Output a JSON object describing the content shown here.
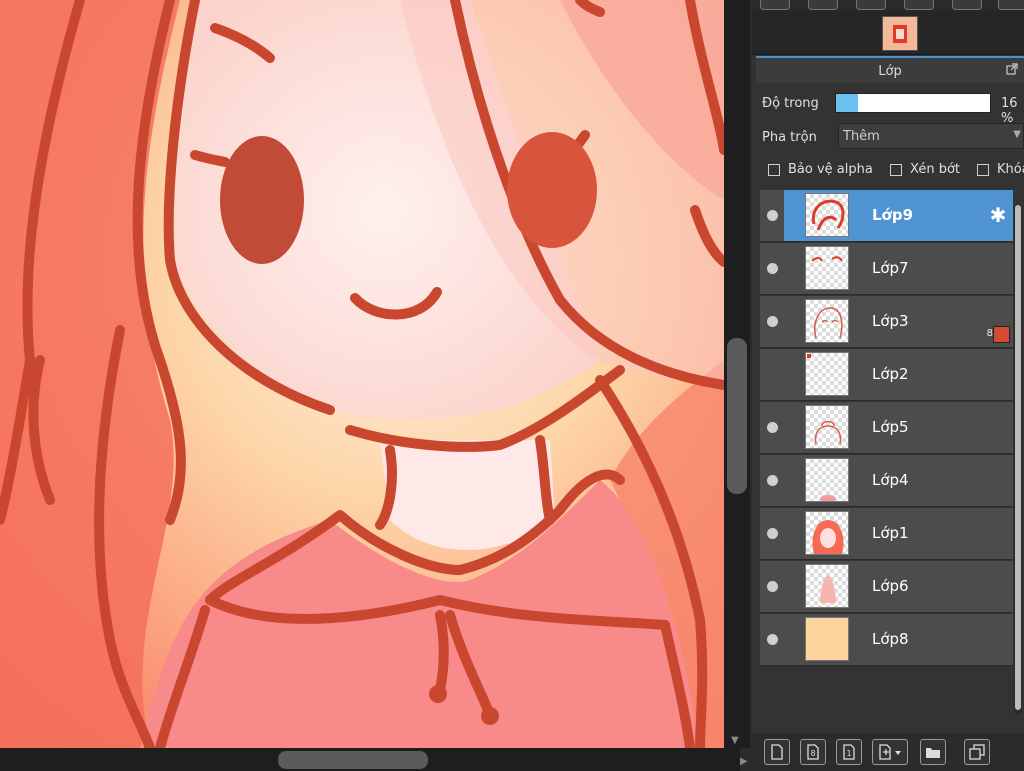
{
  "panel": {
    "title": "Lớp",
    "opacity_label": "Độ trong",
    "opacity_value": "16 %",
    "opacity_fraction": 0.14,
    "blend_label": "Pha trộn",
    "blend_value": "Thêm",
    "checkboxes": [
      "Bảo vệ alpha",
      "Xén bớt",
      "Khóa"
    ]
  },
  "layers": [
    {
      "name": "Lớp9",
      "selected": true,
      "visible": true,
      "has_gear": true
    },
    {
      "name": "Lớp7",
      "selected": false,
      "visible": true
    },
    {
      "name": "Lớp3",
      "selected": false,
      "visible": true,
      "clip_count": "8",
      "clip_color": "#d64a34"
    },
    {
      "name": "Lớp2",
      "selected": false,
      "visible": false
    },
    {
      "name": "Lớp5",
      "selected": false,
      "visible": true
    },
    {
      "name": "Lớp4",
      "selected": false,
      "visible": true
    },
    {
      "name": "Lớp1",
      "selected": false,
      "visible": true
    },
    {
      "name": "Lớp6",
      "selected": false,
      "visible": true
    },
    {
      "name": "Lớp8",
      "selected": false,
      "visible": true,
      "fill": "#fdd49e"
    }
  ],
  "colors": {
    "accent": "#4f93d2",
    "canvas_skin": "#fde0dc",
    "line_art": "#c9472f",
    "hair": "#f46a55",
    "hoodie": "#f98a8a"
  },
  "bottom_toolbar": [
    "new-layer-icon",
    "8bit-layer-icon",
    "1bit-layer-icon",
    "add-layer-menu-icon",
    "folder-icon",
    "duplicate-icon"
  ]
}
